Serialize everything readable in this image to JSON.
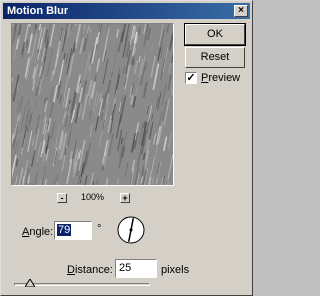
{
  "window": {
    "title": "Motion Blur",
    "close_label": "×"
  },
  "preview": {
    "zoom_minus": "-",
    "zoom_level": "100%",
    "zoom_plus": "+"
  },
  "buttons": {
    "ok": "OK",
    "reset": "Reset"
  },
  "preview_toggle": {
    "label_accel": "P",
    "label_rest": "review",
    "checked": true,
    "check_mark": "✓"
  },
  "angle": {
    "label_accel": "A",
    "label_rest": "ngle:",
    "value": "79",
    "unit": "°",
    "degrees": 79
  },
  "distance": {
    "label_accel": "D",
    "label_rest": "istance:",
    "value": "25",
    "unit": "pixels",
    "fraction": 0.12
  },
  "colors": {
    "titlebar": "#0a246a",
    "face": "#d4d0c8",
    "selection": "#0a246a"
  }
}
